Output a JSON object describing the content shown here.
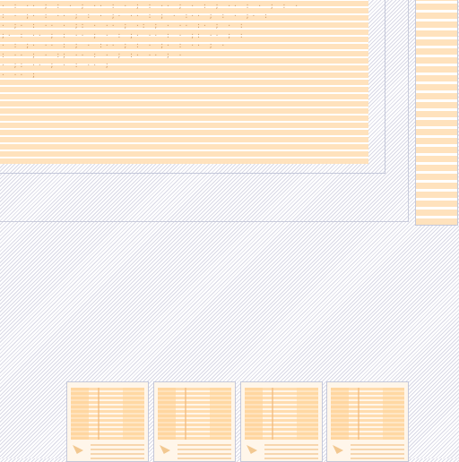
{
  "thumbnails": [
    {
      "id": "page-1"
    },
    {
      "id": "page-2"
    },
    {
      "id": "page-3"
    },
    {
      "id": "page-4"
    }
  ]
}
